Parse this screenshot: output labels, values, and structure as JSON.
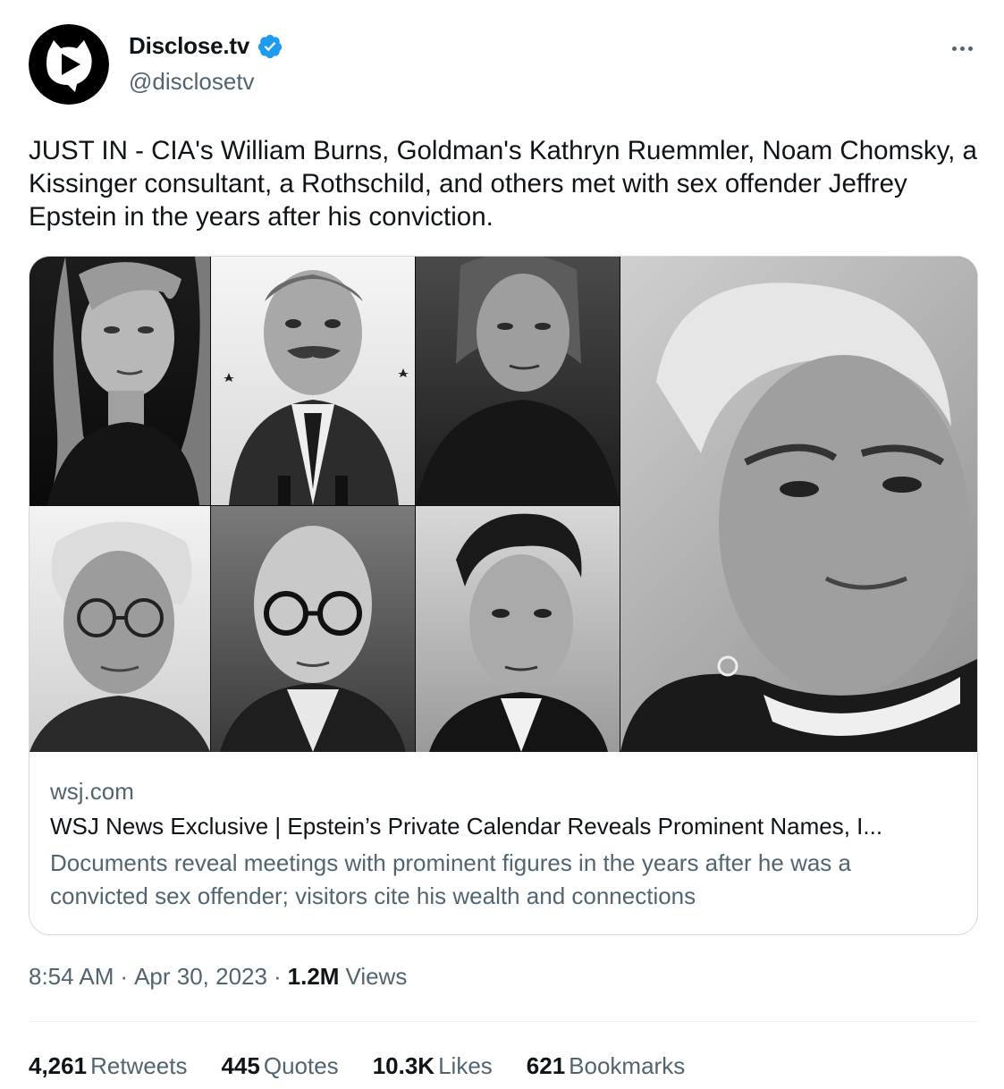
{
  "author": {
    "name": "Disclose.tv",
    "handle": "@disclosetv",
    "verified": true
  },
  "tweet": {
    "text": "JUST IN - CIA's William Burns, Goldman's Kathryn Ruemmler, Noam Chomsky, a Kissinger consultant, a Rothschild, and others met with sex offender Jeffrey Epstein in the years after his conviction."
  },
  "card": {
    "domain": "wsj.com",
    "title": "WSJ News Exclusive | Epstein’s Private Calendar Reveals Prominent Names, I...",
    "description": "Documents reveal meetings with prominent figures in the years after he was a convicted sex offender; visitors cite his wealth and connections"
  },
  "meta": {
    "time": "8:54 AM",
    "separator": "·",
    "date": "Apr 30, 2023",
    "views_count": "1.2M",
    "views_label": "Views"
  },
  "stats": {
    "retweets": {
      "count": "4,261",
      "label": "Retweets"
    },
    "quotes": {
      "count": "445",
      "label": "Quotes"
    },
    "likes": {
      "count": "10.3K",
      "label": "Likes"
    },
    "bookmarks": {
      "count": "621",
      "label": "Bookmarks"
    }
  },
  "colors": {
    "text_primary": "#0f1419",
    "text_secondary": "#536471",
    "verified_blue": "#1d9bf0",
    "border": "#cfd9de"
  },
  "icons": {
    "avatar": "play-speech-bubble-logo",
    "verified": "verified-badge-icon",
    "more": "more-horizontal-icon"
  }
}
